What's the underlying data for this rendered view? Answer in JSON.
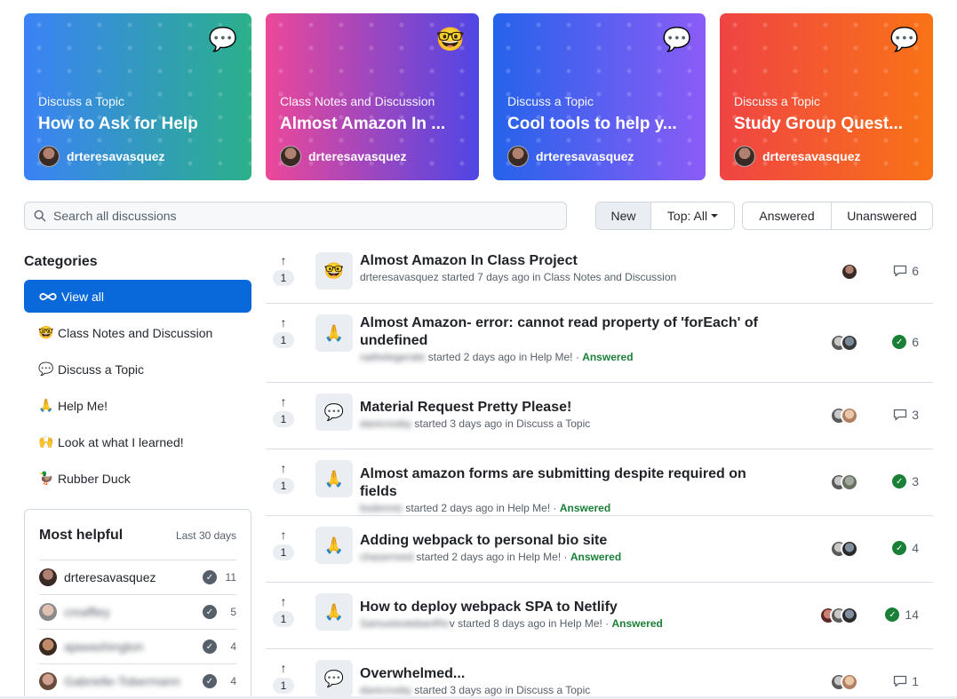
{
  "cards": [
    {
      "category": "Discuss a Topic",
      "title": "How to Ask for Help",
      "author": "drteresavasquez",
      "emoji": "💬",
      "emoji_name": "speech-balloon-icon",
      "gradient": [
        "#3b82f6",
        "#2bb08a"
      ]
    },
    {
      "category": "Class Notes and Discussion",
      "title": "Almost Amazon In ...",
      "author": "drteresavasquez",
      "emoji": "🤓",
      "emoji_name": "nerd-face-icon",
      "gradient": [
        "#ec4899",
        "#4f46e5"
      ]
    },
    {
      "category": "Discuss a Topic",
      "title": "Cool tools to help y...",
      "author": "drteresavasquez",
      "emoji": "💬",
      "emoji_name": "speech-balloon-icon",
      "gradient": [
        "#2563eb",
        "#8b5cf6"
      ]
    },
    {
      "category": "Discuss a Topic",
      "title": "Study Group Quest...",
      "author": "drteresavasquez",
      "emoji": "💬",
      "emoji_name": "speech-balloon-icon",
      "gradient": [
        "#ef4444",
        "#f97316"
      ]
    }
  ],
  "search": {
    "placeholder": "Search all discussions"
  },
  "sort": {
    "new": "New",
    "top": "Top: All"
  },
  "filter": {
    "answered": "Answered",
    "unanswered": "Unanswered"
  },
  "categories": {
    "heading": "Categories",
    "items": [
      {
        "icon": "∞",
        "label": "View all",
        "active": true
      },
      {
        "icon": "🤓",
        "label": "Class Notes and Discussion"
      },
      {
        "icon": "💬",
        "label": "Discuss a Topic"
      },
      {
        "icon": "🙏",
        "label": "Help Me!"
      },
      {
        "icon": "🙌",
        "label": "Look at what I learned!"
      },
      {
        "icon": "🦆",
        "label": "Rubber Duck"
      }
    ]
  },
  "most_helpful": {
    "title": "Most helpful",
    "period": "Last 30 days",
    "users": [
      {
        "name": "drteresavasquez",
        "count": "11",
        "blur": false
      },
      {
        "name": "cmaffley",
        "count": "5",
        "blur": true
      },
      {
        "name": "ajawashington",
        "count": "4",
        "blur": true
      },
      {
        "name": "Gabrielle-Tobermann",
        "count": "4",
        "blur": true
      }
    ]
  },
  "discussions": [
    {
      "title": "Almost Amazon In Class Project",
      "author": "drteresavasquez",
      "author_blur": false,
      "started": "started 7 days ago in Class Notes and Discussion",
      "answered": "",
      "votes": "1",
      "icon": "🤓",
      "count": "6",
      "status": "comments"
    },
    {
      "title": "Almost Amazon- error: cannot read property of 'forEach' of undefined",
      "author": "nathelegerate",
      "author_blur": true,
      "started": "started 2 days ago in Help Me! ·",
      "answered": "Answered",
      "votes": "1",
      "icon": "🙏",
      "count": "6",
      "status": "answered"
    },
    {
      "title": "Material Request Pretty Please!",
      "author": "danicrosby",
      "author_blur": true,
      "started": "started 3 days ago in Discuss a Topic",
      "answered": "",
      "votes": "1",
      "icon": "💬",
      "count": "3",
      "status": "comments"
    },
    {
      "title": "Almost amazon forms are submitting despite required on fields",
      "author": "bsdennis",
      "author_blur": true,
      "started": "started 2 days ago in Help Me! ·",
      "answered": "Answered",
      "votes": "1",
      "icon": "🙏",
      "count": "3",
      "status": "answered"
    },
    {
      "title": "Adding webpack to personal bio site",
      "author": "chaserreed",
      "author_blur": true,
      "started": "started 2 days ago in Help Me! ·",
      "answered": "Answered",
      "votes": "1",
      "icon": "🙏",
      "count": "4",
      "status": "answered"
    },
    {
      "title": "How to deploy webpack SPA to Netlify",
      "author": "SamuelestebanRiv",
      "author_blur": true,
      "started": "v started 8 days ago in Help Me! ·",
      "answered": "Answered",
      "votes": "1",
      "icon": "🙏",
      "count": "14",
      "status": "answered"
    },
    {
      "title": "Overwhelmed...",
      "author": "danicrosby",
      "author_blur": true,
      "started": "started 3 days ago in Discuss a Topic",
      "answered": "",
      "votes": "1",
      "icon": "💬",
      "count": "1",
      "status": "comments"
    }
  ],
  "colors": {
    "accent": "#0969da",
    "answered": "#1a7f37",
    "muted": "#57606a",
    "border": "#d0d7de"
  }
}
